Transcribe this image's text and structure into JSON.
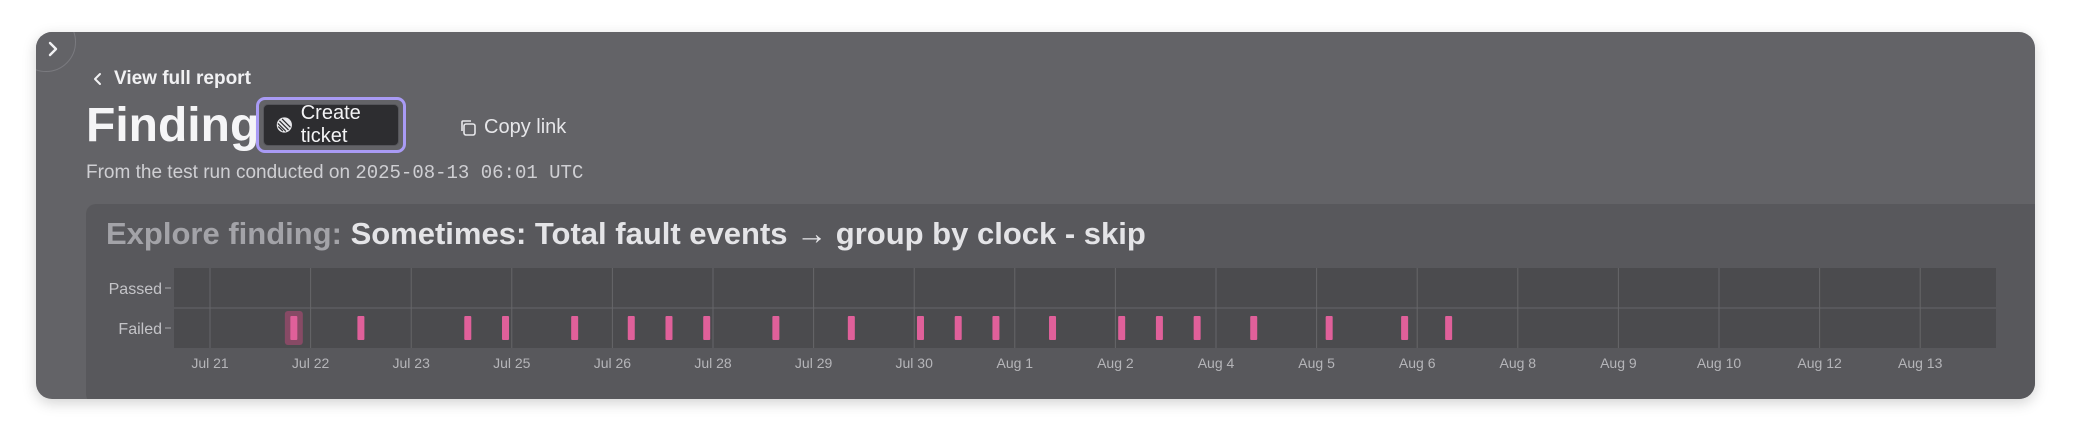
{
  "nav": {
    "back_label": "View full report"
  },
  "header": {
    "title": "Finding",
    "create_ticket_label": "Create ticket",
    "copy_link_label": "Copy link",
    "subtitle_prefix": "From the test run conducted on ",
    "subtitle_timestamp": "2025-08-13 06:01 UTC"
  },
  "explore": {
    "prefix": "Explore finding: ",
    "name": "Sometimes: Total fault events → group by clock - skip"
  },
  "colors": {
    "panel_bg": "#636367",
    "plot_bg": "#4b4b4e",
    "failed_marker": "#e0609a",
    "accent_ring": "#a99bf5"
  },
  "chart_data": {
    "type": "scatter",
    "title": "",
    "y_categories": [
      "Passed",
      "Failed"
    ],
    "x_ticks": [
      "Jul 21",
      "Jul 22",
      "Jul 23",
      "Jul 25",
      "Jul 26",
      "Jul 28",
      "Jul 29",
      "Jul 30",
      "Aug 1",
      "Aug 2",
      "Aug 4",
      "Aug 5",
      "Aug 6",
      "Aug 8",
      "Aug 9",
      "Aug 10",
      "Aug 12",
      "Aug 13"
    ],
    "series": [
      {
        "values": [
          {
            "x": "2025-07-21T20:00",
            "y": "Failed",
            "highlighted": true
          },
          {
            "x": "2025-07-22T12:00",
            "y": "Failed"
          },
          {
            "x": "2025-07-24T03:00",
            "y": "Failed"
          },
          {
            "x": "2025-07-24T21:00",
            "y": "Failed"
          },
          {
            "x": "2025-07-25T15:00",
            "y": "Failed"
          },
          {
            "x": "2025-07-26T09:00",
            "y": "Failed"
          },
          {
            "x": "2025-07-27T03:00",
            "y": "Failed"
          },
          {
            "x": "2025-07-27T21:00",
            "y": "Failed"
          },
          {
            "x": "2025-07-28T15:00",
            "y": "Failed"
          },
          {
            "x": "2025-07-29T09:00",
            "y": "Failed"
          },
          {
            "x": "2025-07-30T03:00",
            "y": "Failed"
          },
          {
            "x": "2025-07-30T21:00",
            "y": "Failed"
          },
          {
            "x": "2025-07-31T15:00",
            "y": "Failed"
          },
          {
            "x": "2025-08-01T09:00",
            "y": "Failed"
          },
          {
            "x": "2025-08-02T03:00",
            "y": "Failed"
          },
          {
            "x": "2025-08-02T21:00",
            "y": "Failed"
          },
          {
            "x": "2025-08-03T15:00",
            "y": "Failed"
          },
          {
            "x": "2025-08-04T09:00",
            "y": "Failed"
          },
          {
            "x": "2025-08-05T03:00",
            "y": "Failed"
          },
          {
            "x": "2025-08-05T21:00",
            "y": "Failed"
          },
          {
            "x": "2025-08-06T15:00",
            "y": "Failed"
          }
        ]
      }
    ],
    "grid": true
  }
}
